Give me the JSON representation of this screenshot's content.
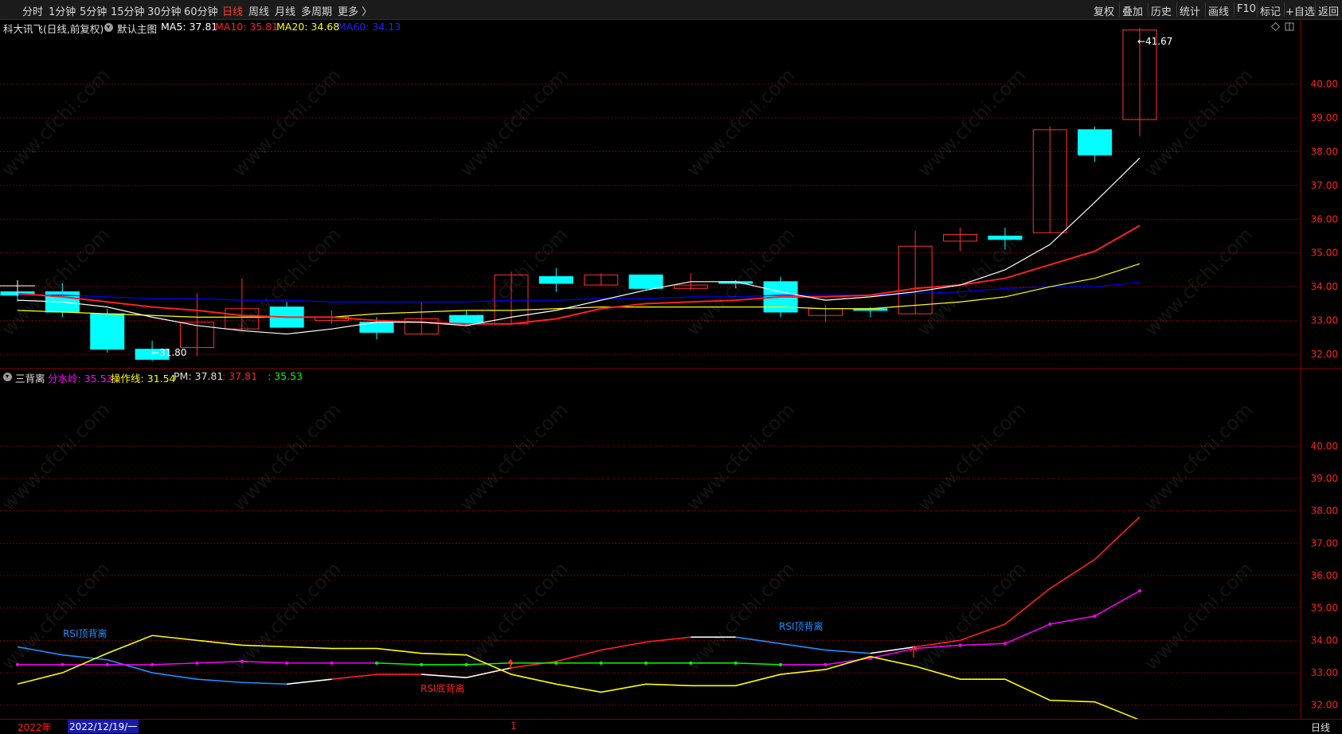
{
  "toolbar": {
    "periods": [
      "分时",
      "1分钟",
      "5分钟",
      "15分钟",
      "30分钟",
      "60分钟",
      "日线",
      "周线",
      "月线",
      "多周期",
      "更多 〉"
    ],
    "active_period": "日线",
    "right_buttons": [
      "复权",
      "叠加",
      "历史",
      "统计",
      "画线",
      "F10",
      "标记",
      "+自选",
      "返回"
    ]
  },
  "main_legend": {
    "stock": "科大讯飞(日线,前复权)",
    "indicator": "默认主图",
    "ma5_label": "MA5: 37.81",
    "ma10_label": "MA10: 35.81",
    "ma20_label": "MA20: 34.68",
    "ma60_label": "MA60: 34.13"
  },
  "sub_legend": {
    "indicator": "三背离",
    "fenshuiling": "分水岭: 35.53",
    "caozuoxian": "操作线: 31.54",
    "pm": "PM: 37.81",
    "red_val": ": 37.81",
    "green_val": ": 35.53"
  },
  "price_axis": {
    "main_ticks": [
      "40.00",
      "39.00",
      "38.00",
      "37.00",
      "36.00",
      "35.00",
      "34.00",
      "33.00",
      "32.00"
    ],
    "sub_ticks": [
      "40.00",
      "39.00",
      "38.00",
      "37.00",
      "36.00",
      "35.00",
      "34.00",
      "33.00",
      "32.00"
    ]
  },
  "annotations": {
    "high_label": "41.67",
    "low_label": "31.80",
    "rsi_top_1": "RSI顶背离",
    "rsi_top_2": "RSI顶背离",
    "rsi_bottom": "RSI底背离"
  },
  "date_bar": {
    "year": "2022年",
    "cursor_date": "2022/12/19/一",
    "tick": "1",
    "period": "日线"
  },
  "watermark": "www.cfchi.com",
  "colors": {
    "up": "#ff3030",
    "down": "#00ffff",
    "ma5": "#ffffff",
    "ma10": "#ff2020",
    "ma20": "#ffff00",
    "ma60": "#0000ff",
    "rsi_blue": "#1e90ff",
    "magenta": "#ff00ff",
    "green": "#00ff00",
    "grid": "#7a0000"
  },
  "chart_data": {
    "type": "candlestick",
    "ylim": [
      31.6,
      41.9
    ],
    "candles": [
      {
        "o": 33.85,
        "h": 33.95,
        "l": 33.55,
        "c": 33.75
      },
      {
        "o": 33.85,
        "h": 34.1,
        "l": 33.1,
        "c": 33.25
      },
      {
        "o": 33.2,
        "h": 33.35,
        "l": 32.05,
        "c": 32.15
      },
      {
        "o": 32.15,
        "h": 32.4,
        "l": 31.8,
        "c": 31.85
      },
      {
        "o": 32.2,
        "h": 33.8,
        "l": 31.95,
        "c": 32.95
      },
      {
        "o": 32.75,
        "h": 34.25,
        "l": 32.7,
        "c": 33.35
      },
      {
        "o": 33.4,
        "h": 33.55,
        "l": 32.8,
        "c": 32.8
      },
      {
        "o": 33.0,
        "h": 33.3,
        "l": 32.9,
        "c": 33.1
      },
      {
        "o": 32.95,
        "h": 33.1,
        "l": 32.45,
        "c": 32.65
      },
      {
        "o": 32.6,
        "h": 33.55,
        "l": 32.6,
        "c": 33.05
      },
      {
        "o": 33.15,
        "h": 33.3,
        "l": 32.85,
        "c": 32.9
      },
      {
        "o": 32.9,
        "h": 34.45,
        "l": 32.9,
        "c": 34.35
      },
      {
        "o": 34.3,
        "h": 34.55,
        "l": 33.85,
        "c": 34.1
      },
      {
        "o": 34.05,
        "h": 34.4,
        "l": 34.05,
        "c": 34.35
      },
      {
        "o": 34.35,
        "h": 34.35,
        "l": 33.9,
        "c": 33.95
      },
      {
        "o": 33.95,
        "h": 34.4,
        "l": 33.9,
        "c": 34.05
      },
      {
        "o": 34.15,
        "h": 34.2,
        "l": 33.95,
        "c": 34.1
      },
      {
        "o": 34.15,
        "h": 34.3,
        "l": 33.1,
        "c": 33.25
      },
      {
        "o": 33.15,
        "h": 33.45,
        "l": 32.95,
        "c": 33.35
      },
      {
        "o": 33.35,
        "h": 33.4,
        "l": 33.1,
        "c": 33.3
      },
      {
        "o": 33.2,
        "h": 35.65,
        "l": 33.2,
        "c": 35.2
      },
      {
        "o": 35.35,
        "h": 35.75,
        "l": 35.05,
        "c": 35.55
      },
      {
        "o": 35.5,
        "h": 35.75,
        "l": 35.1,
        "c": 35.4
      },
      {
        "o": 35.6,
        "h": 38.75,
        "l": 35.6,
        "c": 38.65
      },
      {
        "o": 38.65,
        "h": 38.75,
        "l": 37.7,
        "c": 37.9
      },
      {
        "o": 38.95,
        "h": 41.67,
        "l": 38.45,
        "c": 41.6
      }
    ],
    "ma5": [
      33.6,
      33.55,
      33.4,
      33.1,
      32.85,
      32.7,
      32.6,
      32.75,
      32.95,
      32.95,
      32.85,
      33.1,
      33.3,
      33.6,
      33.9,
      34.15,
      34.15,
      33.85,
      33.6,
      33.7,
      33.85,
      34.05,
      34.5,
      35.25,
      36.5,
      37.81
    ],
    "ma10": [
      33.8,
      33.7,
      33.55,
      33.4,
      33.3,
      33.15,
      33.1,
      33.1,
      33.0,
      32.95,
      32.9,
      32.9,
      33.05,
      33.35,
      33.5,
      33.55,
      33.6,
      33.7,
      33.7,
      33.75,
      33.95,
      34.05,
      34.25,
      34.65,
      35.05,
      35.81
    ],
    "ma20": [
      33.3,
      33.25,
      33.2,
      33.15,
      33.1,
      33.1,
      33.1,
      33.1,
      33.2,
      33.25,
      33.3,
      33.3,
      33.35,
      33.4,
      33.4,
      33.4,
      33.4,
      33.4,
      33.35,
      33.35,
      33.45,
      33.55,
      33.7,
      34.0,
      34.25,
      34.68
    ],
    "ma60": [
      33.75,
      33.75,
      33.7,
      33.65,
      33.65,
      33.6,
      33.6,
      33.55,
      33.55,
      33.55,
      33.55,
      33.6,
      33.6,
      33.65,
      33.65,
      33.7,
      33.7,
      33.75,
      33.75,
      33.75,
      33.8,
      33.85,
      33.95,
      34.0,
      34.0,
      34.13
    ],
    "sub": {
      "ylim": [
        31.6,
        41.9
      ],
      "pm": [
        33.8,
        33.55,
        33.4,
        33.0,
        32.8,
        32.7,
        32.65,
        32.8,
        32.95,
        32.95,
        32.85,
        33.15,
        33.35,
        33.7,
        33.95,
        34.1,
        34.1,
        33.9,
        33.7,
        33.6,
        33.8,
        34.0,
        34.5,
        35.6,
        36.5,
        37.81
      ],
      "fenshuiling": [
        33.25,
        33.25,
        33.25,
        33.25,
        33.3,
        33.35,
        33.3,
        33.3,
        33.3,
        33.25,
        33.25,
        33.3,
        33.3,
        33.3,
        33.3,
        33.3,
        33.3,
        33.25,
        33.25,
        33.45,
        33.75,
        33.85,
        33.9,
        34.5,
        34.75,
        35.53
      ],
      "caozuoxian": [
        32.65,
        33.0,
        33.6,
        34.15,
        34.0,
        33.85,
        33.8,
        33.75,
        33.75,
        33.6,
        33.55,
        32.95,
        32.65,
        32.4,
        32.65,
        32.6,
        32.6,
        32.95,
        33.1,
        33.5,
        33.2,
        32.8,
        32.8,
        32.15,
        32.1,
        31.54
      ]
    }
  }
}
